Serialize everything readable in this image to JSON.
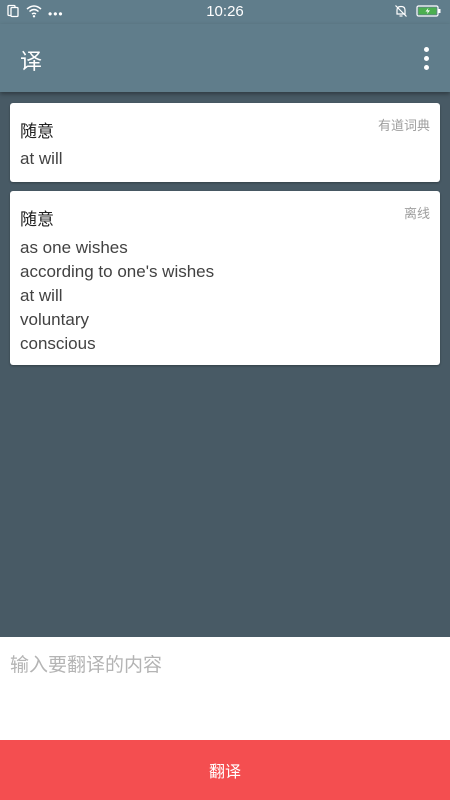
{
  "status_bar": {
    "time": "10:26",
    "icons": [
      "sim-card-icon",
      "wifi-icon",
      "more-dots-icon",
      "notification-muted-icon",
      "battery-charging-icon"
    ]
  },
  "app_bar": {
    "title": "译",
    "menu_icon": "more-vert-icon"
  },
  "results": [
    {
      "word": "随意",
      "source": "有道词典",
      "translations": [
        "at will"
      ]
    },
    {
      "word": "随意",
      "source": "离线",
      "translations": [
        "as one wishes",
        "according to one's wishes",
        "at will",
        "voluntary",
        "conscious"
      ]
    }
  ],
  "input": {
    "placeholder": "输入要翻译的内容",
    "value": ""
  },
  "translate_button": {
    "label": "翻译"
  },
  "colors": {
    "primary": "#607d8b",
    "background": "#485a65",
    "accent": "#f44e50",
    "card": "#ffffff"
  }
}
